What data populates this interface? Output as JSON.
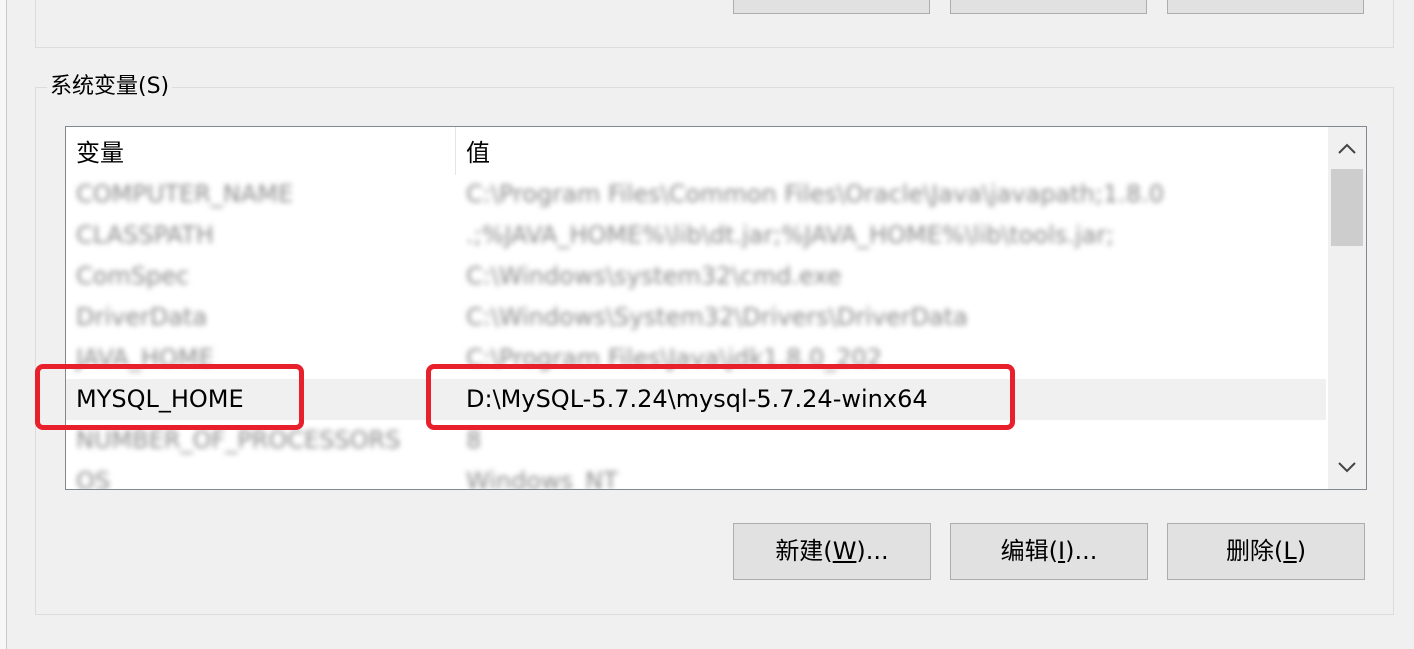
{
  "group_label": "系统变量(S)",
  "columns": {
    "name": "变量",
    "value": "值"
  },
  "rows": [
    {
      "name": "COMPUTER_NAME",
      "value": "C:\\Program Files\\Common Files\\Oracle\\Java\\javapath;1.8.0"
    },
    {
      "name": "CLASSPATH",
      "value": ".;%JAVA_HOME%\\lib\\dt.jar;%JAVA_HOME%\\lib\\tools.jar;"
    },
    {
      "name": "ComSpec",
      "value": "C:\\Windows\\system32\\cmd.exe"
    },
    {
      "name": "DriverData",
      "value": "C:\\Windows\\System32\\Drivers\\DriverData"
    },
    {
      "name": "JAVA_HOME",
      "value": "C:\\Program Files\\Java\\jdk1.8.0_202"
    },
    {
      "name": "MYSQL_HOME",
      "value": "D:\\MySQL-5.7.24\\mysql-5.7.24-winx64"
    },
    {
      "name": "NUMBER_OF_PROCESSORS",
      "value": "8"
    },
    {
      "name": "OS",
      "value": "Windows_NT"
    }
  ],
  "buttons": {
    "new": {
      "label": "新建(",
      "mnemonic": "W",
      "suffix": ")..."
    },
    "edit": {
      "label": "编辑(",
      "mnemonic": "I",
      "suffix": ")..."
    },
    "delete": {
      "label": "删除(",
      "mnemonic": "L",
      "suffix": ")"
    }
  },
  "highlight_color": "#e8202c",
  "icons": {
    "scroll_up": "chevron-up-icon",
    "scroll_down": "chevron-down-icon"
  }
}
